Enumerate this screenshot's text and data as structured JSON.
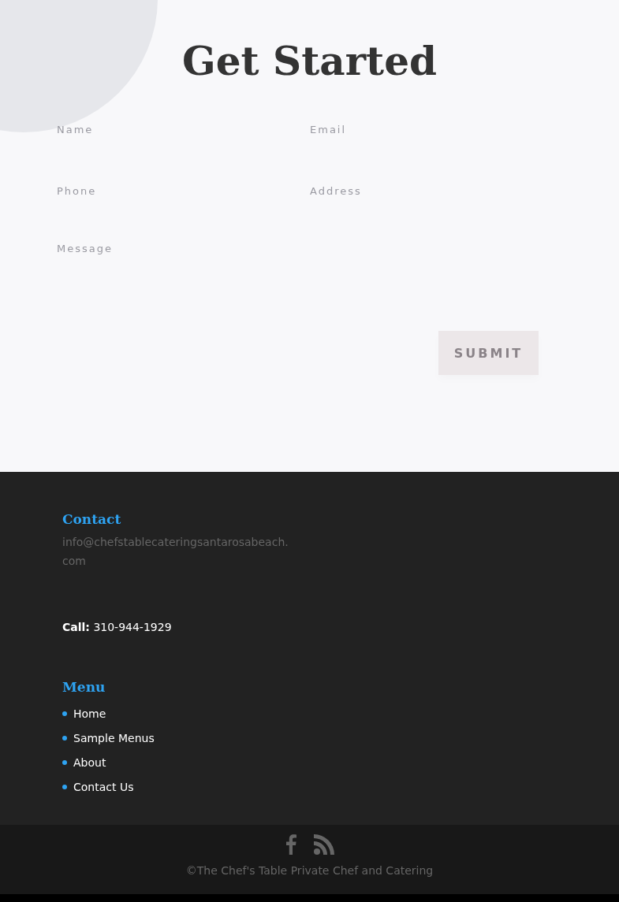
{
  "hero": {
    "title": "Get Started"
  },
  "form": {
    "fields": [
      {
        "placeholder": "Name",
        "kind": "input"
      },
      {
        "placeholder": "Email",
        "kind": "input"
      },
      {
        "placeholder": "Phone",
        "kind": "input"
      },
      {
        "placeholder": "Address",
        "kind": "input"
      },
      {
        "placeholder": "Message",
        "kind": "textarea"
      }
    ],
    "submit": "SUBMIT"
  },
  "footer": {
    "contact_heading": "Contact",
    "email": "info@chefstablecateringsantarosabeach.com",
    "call_label": "Call:",
    "phone": "310-944-1929",
    "menu_heading": "Menu",
    "menu": [
      "Home",
      "Sample Menus",
      "About",
      "Contact Us"
    ]
  },
  "bottom_bar": {
    "social": [
      {
        "kind": "facebook"
      },
      {
        "kind": "rss"
      }
    ],
    "copyright": "©The Chef's Table Private Chef and Catering"
  }
}
